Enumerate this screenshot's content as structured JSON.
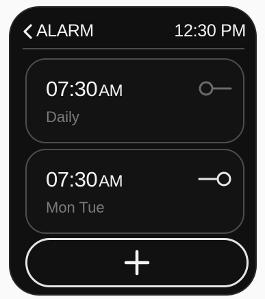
{
  "header": {
    "back_label": "ALARM",
    "time": "12:30 PM"
  },
  "alarms": [
    {
      "time": "07:30",
      "ampm": "AM",
      "days": "Daily",
      "enabled": false
    },
    {
      "time": "07:30",
      "ampm": "AM",
      "days": "Mon Tue",
      "enabled": true
    }
  ],
  "colors": {
    "screen_bg": "#101010",
    "text_primary": "#f4f4f4",
    "text_secondary": "#7a7a7a",
    "card_border": "#4d4d4d"
  },
  "icons": {
    "back": "chevron-left-icon",
    "toggle": "toggle-switch-icon",
    "add": "plus-icon"
  }
}
